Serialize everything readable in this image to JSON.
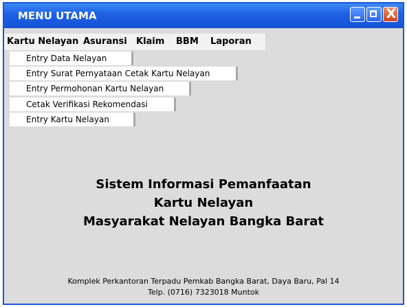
{
  "window": {
    "title": "MENU UTAMA",
    "accent_color": "#1f62e6",
    "close_color": "#d1461b",
    "controls": {
      "minimize_icon": "minimize-icon",
      "maximize_icon": "maximize-icon",
      "close_icon": "close-icon",
      "close_glyph": "X"
    }
  },
  "menubar": {
    "items": [
      {
        "label": "Kartu Nelayan"
      },
      {
        "label": "Asuransi"
      },
      {
        "label": "Klaim"
      },
      {
        "label": "BBM"
      },
      {
        "label": "Laporan"
      }
    ]
  },
  "submenu": {
    "parent": "Kartu Nelayan",
    "items": [
      {
        "label": "Entry Data Nelayan"
      },
      {
        "label": "Entry Surat Pernyataan Cetak Kartu Nelayan"
      },
      {
        "label": "Entry Permohonan Kartu Nelayan"
      },
      {
        "label": "Cetak Verifikasi Rekomendasi"
      },
      {
        "label": "Entry Kartu Nelayan"
      }
    ]
  },
  "main": {
    "headline": [
      "Sistem Informasi Pemanfaatan",
      "Kartu Nelayan",
      "Masyarakat Nelayan Bangka Barat"
    ],
    "footer": [
      "Komplek Perkantoran Terpadu Pemkab Bangka Barat, Daya Baru, Pal 14",
      "Telp. (0716) 7323018 Muntok"
    ]
  }
}
